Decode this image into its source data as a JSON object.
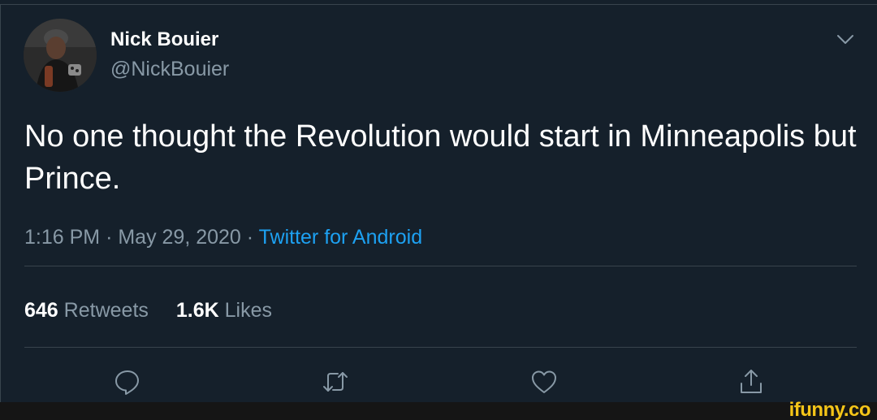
{
  "tweet": {
    "author": {
      "name": "Nick Bouier",
      "handle": "@NickBouier"
    },
    "text": "No one thought the Revolution would start in Minneapolis but Prince.",
    "time": "1:16 PM",
    "date": "May 29, 2020",
    "source": "Twitter for Android",
    "separator": "·",
    "stats": {
      "retweets_count": "646",
      "retweets_label": "Retweets",
      "likes_count": "1.6K",
      "likes_label": "Likes"
    }
  },
  "actions": [
    "reply-icon",
    "retweet-icon",
    "like-icon",
    "share-icon"
  ],
  "watermark": "ifunny.co",
  "colors": {
    "background": "#15202b",
    "text": "#ffffff",
    "secondary": "#8899a6",
    "link": "#1da1f2",
    "divider": "#38444d",
    "watermark": "#f5c518"
  }
}
